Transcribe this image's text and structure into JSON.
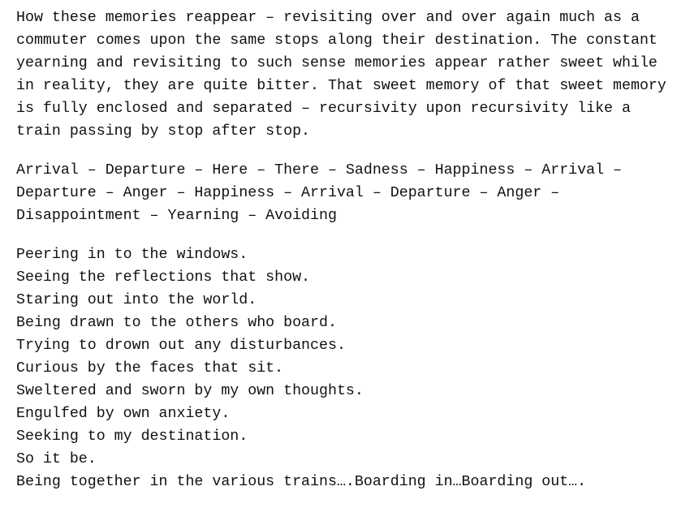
{
  "document": {
    "paragraph1": "How these memories reappear – revisiting over and over again much as a commuter comes upon the same stops along their destination. The constant yearning and revisiting to such sense memories appear rather sweet while in reality, they are quite bitter. That sweet memory of that sweet memory is fully enclosed and separated – recursivity upon recursivity like a train passing by stop after stop.",
    "paragraph2": "Arrival – Departure – Here – There – Sadness – Happiness – Arrival – Departure – Anger – Happiness – Arrival – Departure – Anger – Disappointment – Yearning – Avoiding",
    "poem_lines": [
      "Peering in to the windows.",
      "Seeing the reflections that show.",
      "Staring out into the world.",
      "Being drawn to the others who board.",
      "Trying to drown out any disturbances.",
      "Curious by the faces that sit.",
      "Sweltered and sworn by my own thoughts.",
      "Engulfed by own anxiety.",
      "Seeking to my destination.",
      "So it be.",
      "Being together in the various trains….Boarding in…Boarding out…."
    ]
  }
}
